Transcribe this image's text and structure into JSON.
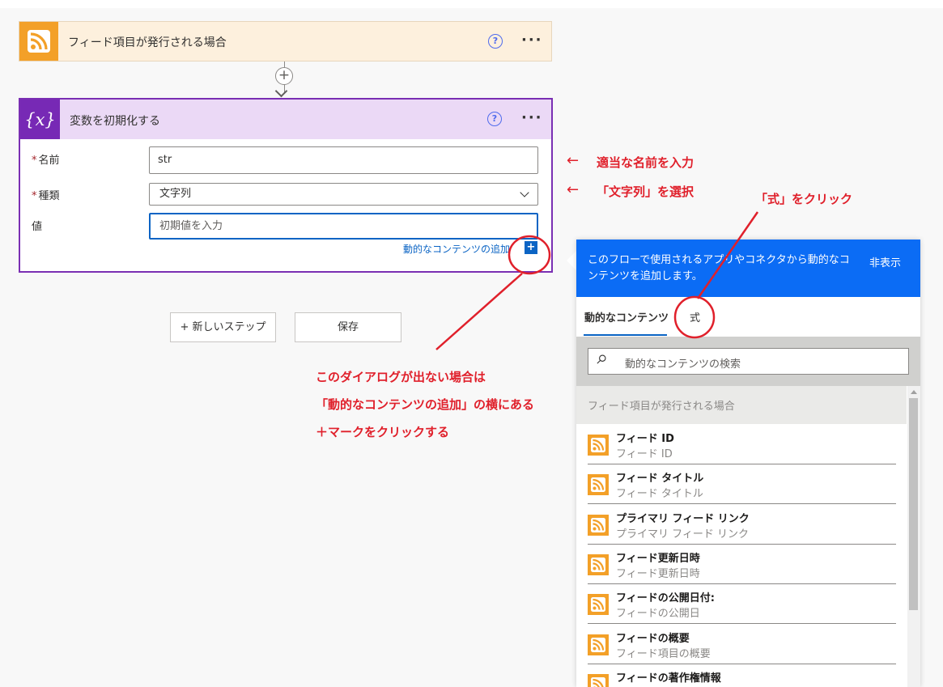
{
  "trigger": {
    "title": "フィード項目が発行される場合",
    "help": "?",
    "more": "···",
    "icon": "rss-icon"
  },
  "connector": {
    "add": "+"
  },
  "variable": {
    "icon_text": "{x}",
    "title": "変数を初期化する",
    "help": "?",
    "more": "···",
    "name_label": "名前",
    "name_value": "str",
    "type_label": "種類",
    "type_value": "文字列",
    "value_label": "値",
    "value_placeholder": "初期値を入力",
    "dynamic_link": "動的なコンテンツの追加",
    "plus": "+",
    "required_mark": "*"
  },
  "buttons": {
    "new_step": "+ 新しいステップ",
    "save": "保存"
  },
  "annotations": {
    "arrow1": "←",
    "name_hint": "適当な名前を入力",
    "arrow2": "←",
    "type_hint": "「文字列」を選択",
    "expression_hint": "「式」をクリック",
    "dialog_line1": "このダイアログが出ない場合は",
    "dialog_line2": "「動的なコンテンツの追加」の横にある",
    "dialog_line3": "＋マークをクリックする"
  },
  "panel": {
    "header": "このフローで使用されるアプリやコネクタから動的なコンテンツを追加します。",
    "hide": "非表示",
    "tab_dynamic": "動的なコンテンツ",
    "tab_expression": "式",
    "search_placeholder": "動的なコンテンツの検索",
    "section": "フィード項目が発行される場合",
    "items": [
      {
        "title": "フィード ID",
        "subtitle": "フィード ID"
      },
      {
        "title": "フィード タイトル",
        "subtitle": "フィード タイトル"
      },
      {
        "title": "プライマリ フィード リンク",
        "subtitle": "プライマリ フィード リンク"
      },
      {
        "title": "フィード更新日時",
        "subtitle": "フィード更新日時"
      },
      {
        "title": "フィードの公開日付:",
        "subtitle": "フィードの公開日"
      },
      {
        "title": "フィードの概要",
        "subtitle": "フィード項目の概要"
      },
      {
        "title": "フィードの著作権情報",
        "subtitle": ""
      }
    ]
  },
  "colors": {
    "accent": "#0b64c4",
    "panel_header": "#0b6cf5",
    "rss": "#f3a028",
    "variable": "#7729b5",
    "annotation": "#e0202b"
  }
}
